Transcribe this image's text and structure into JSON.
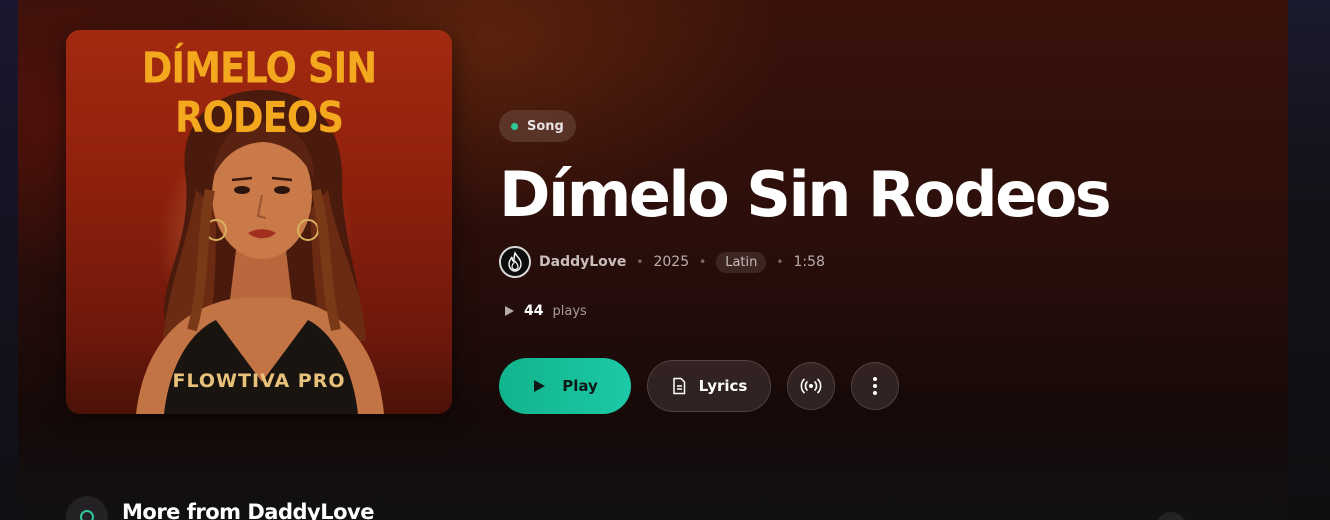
{
  "cover": {
    "title_text": "DÍMELO SIN RODEOS",
    "brand_text": "FLOWTIVA PRO",
    "colors": {
      "background": "#9a2510",
      "title": "#f3a81e",
      "brand": "#e8c27a"
    }
  },
  "song": {
    "type_label": "Song",
    "title": "Dímelo Sin Rodeos",
    "artist": "DaddyLove",
    "year": "2025",
    "genre": "Latin",
    "duration": "1:58",
    "plays_count": "44",
    "plays_label": "plays"
  },
  "actions": {
    "play_label": "Play",
    "lyrics_label": "Lyrics",
    "radio_icon": "broadcast-icon",
    "more_icon": "more-vertical-icon"
  },
  "section": {
    "title": "More from DaddyLove"
  },
  "colors": {
    "accent": "#1cc9a6",
    "status_dot": "#2ec99a"
  }
}
